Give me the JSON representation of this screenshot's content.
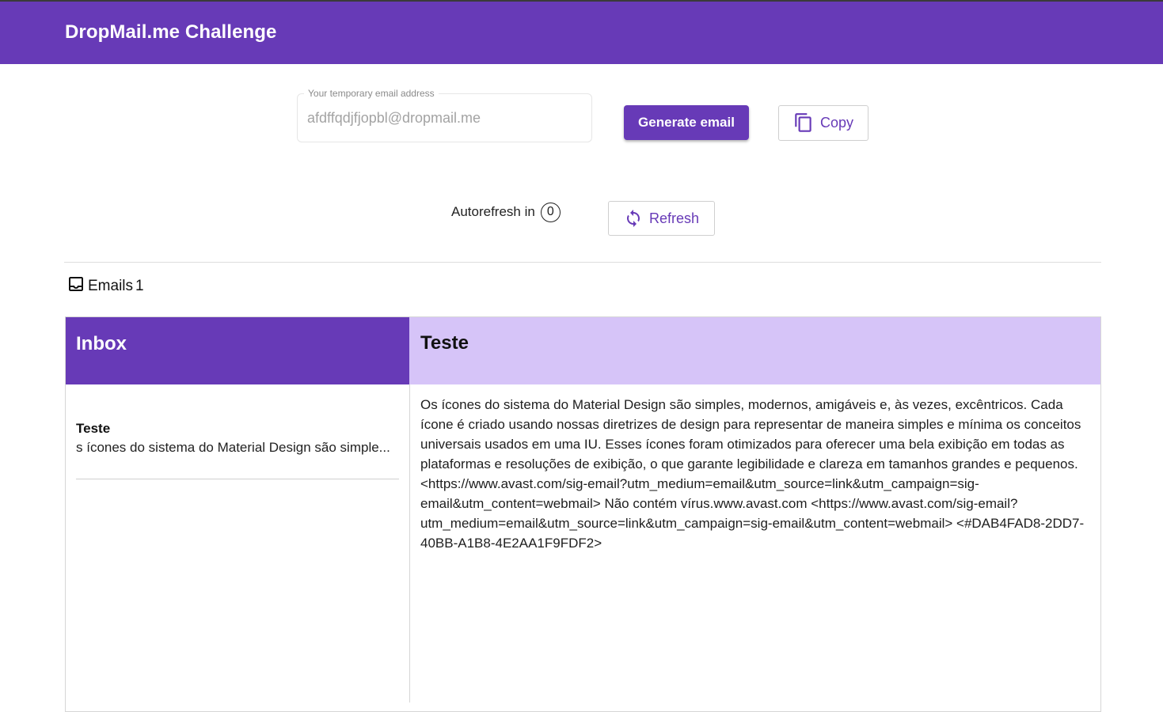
{
  "app": {
    "title": "DropMail.me Challenge"
  },
  "email_field": {
    "label": "Your temporary email address",
    "value": "afdffqdjfjopbl@dropmail.me"
  },
  "buttons": {
    "generate": "Generate email",
    "copy": "Copy",
    "refresh": "Refresh"
  },
  "autorefresh": {
    "label": "Autorefresh in",
    "count": "0"
  },
  "emails_summary": {
    "label": "Emails",
    "count": "1"
  },
  "inbox": {
    "title": "Inbox",
    "items": [
      {
        "subject": "Teste",
        "preview": "s ícones do sistema do Material Design são simple..."
      }
    ]
  },
  "selected_email": {
    "subject": "Teste",
    "body": "Os ícones do sistema do Material Design são simples, modernos, amigáveis e, às vezes, excêntricos. Cada ícone é criado usando nossas diretrizes de design para representar de maneira simples e mínima os conceitos universais usados em uma IU. Esses ícones foram otimizados para oferecer uma bela exibição em todas as plataformas e resoluções de exibição, o que garante legibilidade e clareza em tamanhos grandes e pequenos. <https://www.avast.com/sig-email?utm_medium=email&utm_source=link&utm_campaign=sig-email&utm_content=webmail> Não contém vírus.www.avast.com <https://www.avast.com/sig-email?utm_medium=email&utm_source=link&utm_campaign=sig-email&utm_content=webmail> <#DAB4FAD8-2DD7-40BB-A1B8-4E2AA1F9FDF2>"
  },
  "icons": {
    "copy": "copy-icon",
    "refresh": "refresh-icon",
    "inbox": "inbox-icon"
  },
  "colors": {
    "primary": "#673ab7",
    "detail_header": "#d6c4f8"
  }
}
